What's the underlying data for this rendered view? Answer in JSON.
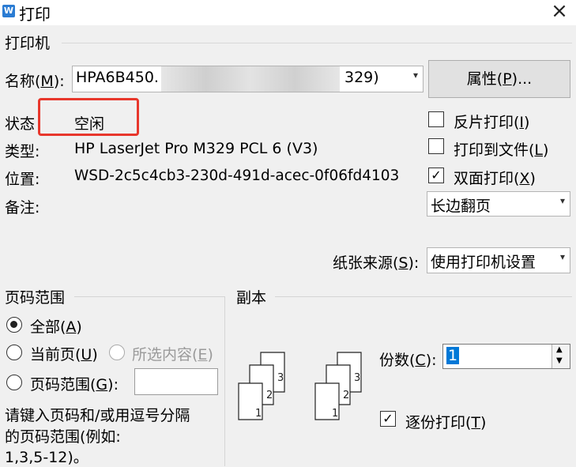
{
  "window": {
    "title": "打印",
    "app_icon": "W",
    "close": "×"
  },
  "printer": {
    "section_label": "打印机",
    "name_label": "名称(M):",
    "name_value_prefix": "HPA6B450.",
    "name_value_suffix": "329)",
    "properties_button": "属性(P)...",
    "status_label": "状态",
    "status_value": "空闲",
    "type_label": "类型:",
    "type_value": "HP LaserJet Pro M329 PCL 6 (V3)",
    "location_label": "位置:",
    "location_value": "WSD-2c5c4cb3-230d-491d-acec-0f06fd4103",
    "comment_label": "备注:",
    "reverse_print": {
      "label": "反片打印(I)",
      "checked": false
    },
    "print_to_file": {
      "label": "打印到文件(L)",
      "checked": false
    },
    "duplex": {
      "label": "双面打印(X)",
      "checked": true
    },
    "duplex_mode": "长边翻页",
    "paper_source_label": "纸张来源(S):",
    "paper_source_value": "使用打印机设置"
  },
  "page_range": {
    "section_label": "页码范围",
    "all": "全部(A)",
    "current": "当前页(U)",
    "selection": "所选内容(E)",
    "range": "页码范围(G):",
    "hint_line1": "请键入页码和/或用逗号分隔",
    "hint_line2": "的页码范围(例如:",
    "hint_line3": "1,3,5-12)。"
  },
  "copies": {
    "section_label": "副本",
    "count_label": "份数(C):",
    "count_value": "1",
    "collate": {
      "label": "逐份打印(T)",
      "checked": true
    }
  }
}
